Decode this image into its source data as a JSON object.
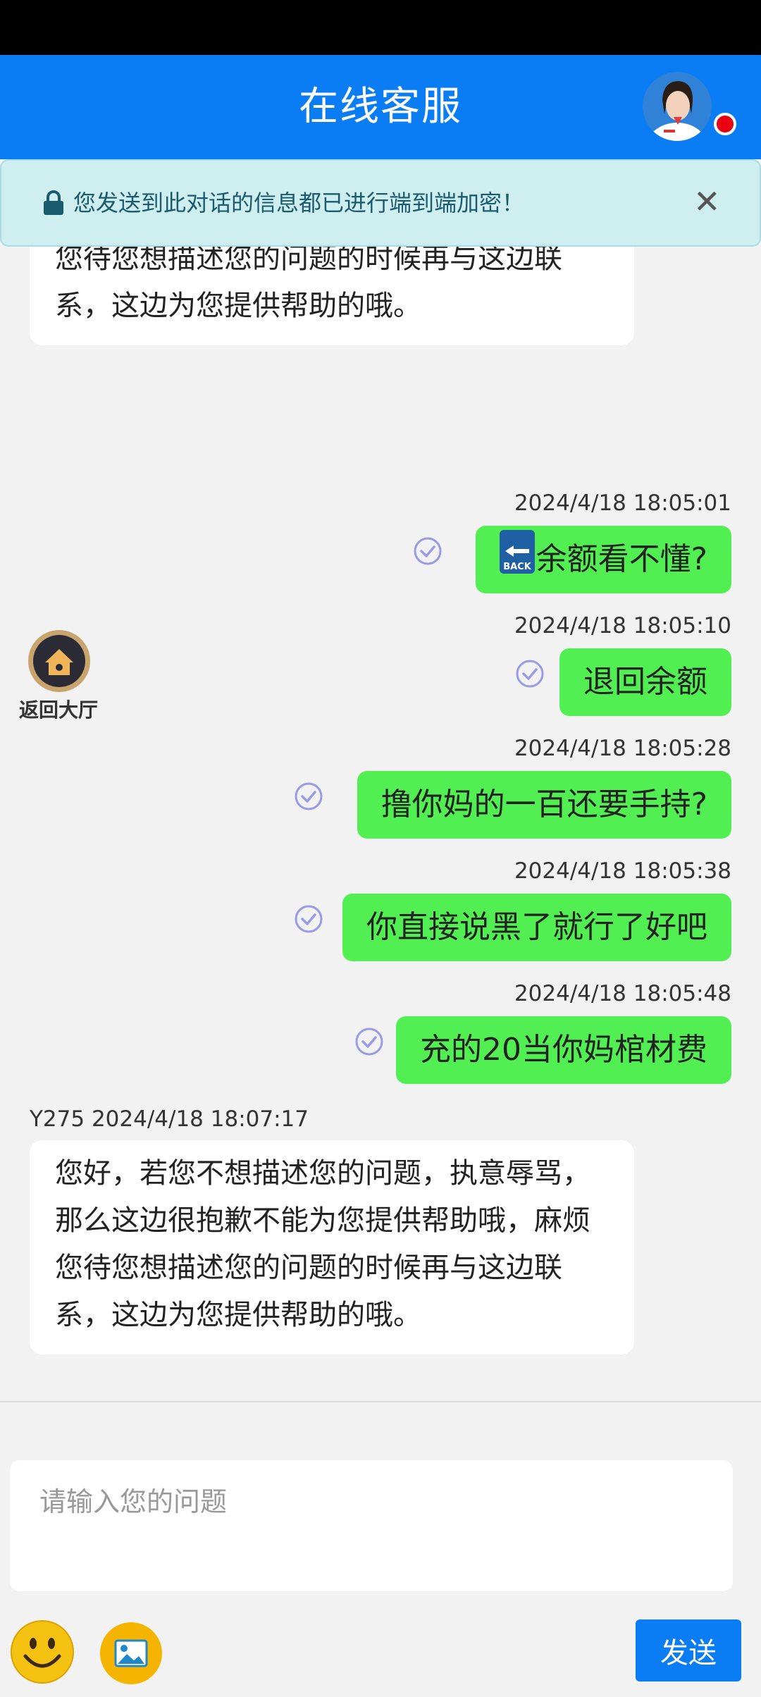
{
  "header": {
    "title": "在线客服",
    "avatar": "customer-service-agent-avatar",
    "status": "online-red-dot"
  },
  "banner": {
    "text": "您发送到此对话的信息都已进行端到端加密！",
    "lock_icon": "lock-icon",
    "close_icon": "close-icon"
  },
  "messages": {
    "incoming_1": {
      "text": "您好，若您不想描述您的问题，执意辱骂，那么这边很抱歉不能为您提供帮助哦，麻烦您待您想描述您的问题的时候再与这边联系，这边为您提供帮助的哦。"
    },
    "outgoing": [
      {
        "time": "2024/4/18 18:05:01",
        "text": "余额看不懂?"
      },
      {
        "time": "2024/4/18 18:05:10",
        "text": "退回余额"
      },
      {
        "time": "2024/4/18 18:05:28",
        "text": "撸你妈的一百还要手持?"
      },
      {
        "time": "2024/4/18 18:05:38",
        "text": "你直接说黑了就行了好吧"
      },
      {
        "time": "2024/4/18 18:05:48",
        "text": "充的20当你妈棺材费"
      }
    ],
    "back_icon": "back-arrow-emoji-icon",
    "incoming_2": {
      "meta": "Y275 2024/4/18 18:07:17",
      "text": "您好，若您不想描述您的问题，执意辱骂，那么这边很抱歉不能为您提供帮助哦，麻烦您待您想描述您的问题的时候再与这边联系，这边为您提供帮助的哦。"
    }
  },
  "lobby": {
    "label": "返回大厅",
    "icon": "home-icon"
  },
  "composer": {
    "placeholder": "请输入您的问题",
    "emoji_icon": "smiley-icon",
    "image_icon": "image-icon",
    "send_label": "发送"
  },
  "colors": {
    "header": "#0a7df5",
    "outgoing_bubble": "#52ef52",
    "banner_bg": "#cfeef0",
    "send_button": "#0a7df5"
  }
}
